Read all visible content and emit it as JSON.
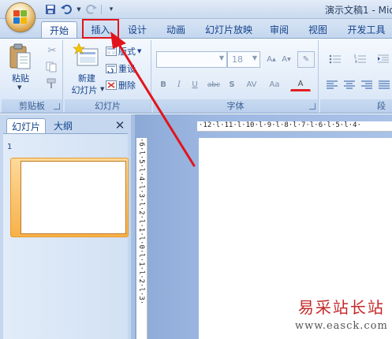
{
  "title_bar": {
    "app_title": "演示文稿1 - Mic"
  },
  "quick_access": {
    "icons": [
      "save-icon",
      "undo-icon",
      "redo-icon",
      "customize-icon"
    ]
  },
  "tabs": [
    {
      "label": "开始",
      "active": true
    },
    {
      "label": "插入",
      "active": false,
      "highlighted": true
    },
    {
      "label": "设计",
      "active": false
    },
    {
      "label": "动画",
      "active": false
    },
    {
      "label": "幻灯片放映",
      "active": false
    },
    {
      "label": "审阅",
      "active": false
    },
    {
      "label": "视图",
      "active": false
    },
    {
      "label": "开发工具",
      "active": false
    }
  ],
  "ribbon": {
    "clipboard": {
      "label": "剪贴板",
      "paste_label": "粘贴"
    },
    "slides": {
      "label": "幻灯片",
      "new_slide_line1": "新建",
      "new_slide_line2": "幻灯片",
      "layout_label": "版式",
      "reset_label": "重设",
      "delete_label": "删除"
    },
    "font": {
      "label": "字体",
      "font_name": "",
      "font_size": "18",
      "format_buttons": [
        "B",
        "I",
        "U",
        "abc",
        "S",
        "AV",
        "Aa",
        "A"
      ]
    },
    "paragraph": {
      "label": "段落"
    }
  },
  "left_panel": {
    "tabs": [
      "幻灯片",
      "大纲"
    ],
    "close_label": "✕",
    "slide_number": "1"
  },
  "rulers": {
    "horizontal": "·12·l·11·l·10·l·9·l·8·l·7·l·6·l·5·l·4·",
    "vertical": "·6·l·5·l·4·l·3·l·2·l·1·l·0·l·1·l·2·l·3·"
  },
  "watermark": {
    "title": "易采站长站",
    "url": "www.easck.com"
  },
  "colors": {
    "highlight": "#e2141b",
    "accent": "#15428b",
    "ribbon_bg": "#e3edf9"
  }
}
